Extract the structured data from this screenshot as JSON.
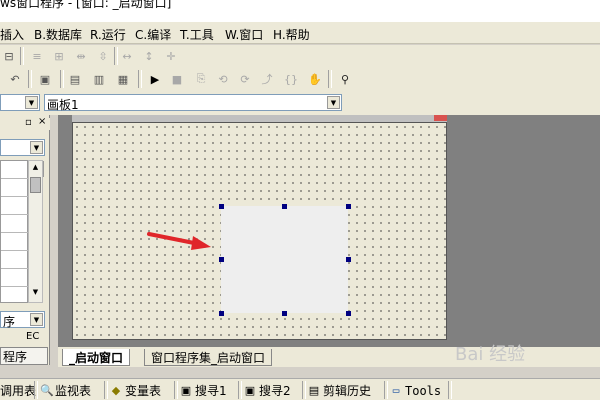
{
  "window": {
    "title": "ws窗口程序 - [窗口: _启动窗口]"
  },
  "menu": [
    {
      "label": "插入"
    },
    {
      "label": "B.数据库"
    },
    {
      "label": "R.运行"
    },
    {
      "label": "C.编译"
    },
    {
      "label": "T.工具"
    },
    {
      "label": "W.窗口"
    },
    {
      "label": "H.帮助"
    }
  ],
  "combos": {
    "left_value": "",
    "board_value": "画板1"
  },
  "left_panel": {
    "bottom_select": "序",
    "label_ec": "EC",
    "tab_program": "程序"
  },
  "doc_tabs": [
    {
      "label": "_启动窗口"
    },
    {
      "label": "窗口程序集_启动窗口"
    }
  ],
  "bottom_tabs": [
    {
      "label": "调用表",
      "icon": "table-icon"
    },
    {
      "label": "监视表",
      "icon": "magnifier-icon"
    },
    {
      "label": "变量表",
      "icon": "variable-icon"
    },
    {
      "label": "搜寻1",
      "icon": "search-icon"
    },
    {
      "label": "搜寻2",
      "icon": "search-icon"
    },
    {
      "label": "剪辑历史",
      "icon": "clipboard-icon"
    },
    {
      "label": "Tools",
      "icon": "window-icon"
    }
  ],
  "watermark": "Bai 经验"
}
